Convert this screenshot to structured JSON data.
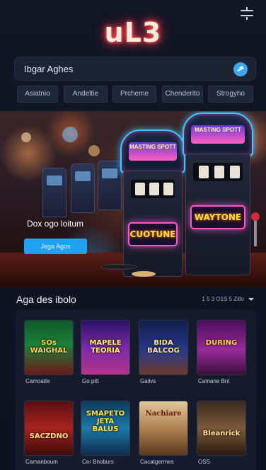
{
  "header": {
    "logo": "uL3",
    "menu_icon": "sliders-icon"
  },
  "search": {
    "value": "Ibgar Aghes",
    "icon": "send-icon",
    "accent": "#3aa7f0"
  },
  "chips": [
    "Asiatnio",
    "Andeltie",
    "Prcheme",
    "Chenderito",
    "Strogyho"
  ],
  "hero": {
    "title": "Dox ogo loitum",
    "button_label": "Jega Agos",
    "machine_left_sign": "CUOTUNE",
    "machine_left_top": "MASTING SPOTT",
    "machine_right_sign": "WAYTONE",
    "machine_right_top": "MASTING SPOTT"
  },
  "section": {
    "title": "Aga des ibolo",
    "sort_label": "1 5 3 O1S 5 Zillo"
  },
  "games": [
    {
      "name": "Camoatte",
      "art": "SOs\nWAIGHAL",
      "palette": "green"
    },
    {
      "name": "Go pitt",
      "art": "MAPELE\nTEORIA",
      "palette": "purple"
    },
    {
      "name": "Gailvs",
      "art": "BIDA\nBALCOG",
      "palette": "blue"
    },
    {
      "name": "Camane Bnt",
      "art": "DURING",
      "palette": "magenta"
    },
    {
      "name": "Camanboum",
      "art": "SACZDNO",
      "palette": "red"
    },
    {
      "name": "Cer Bnoburs",
      "art": "SMAPETO\nJETA\nBALUS",
      "palette": "teal"
    },
    {
      "name": "Cacatgermes",
      "art": "Nachiare",
      "palette": "sand"
    },
    {
      "name": "OSS",
      "art": "Bleanrick",
      "palette": "brown"
    }
  ]
}
